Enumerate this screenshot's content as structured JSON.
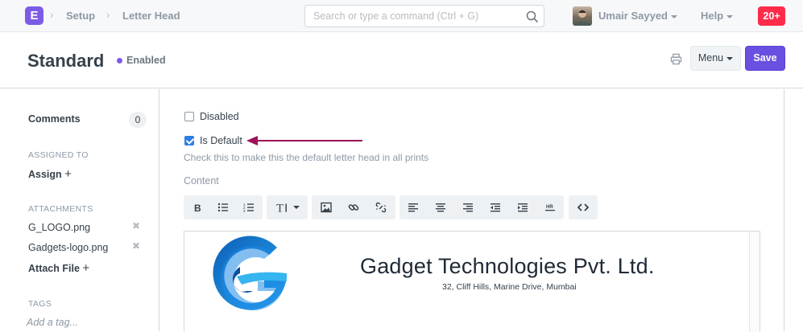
{
  "navbar": {
    "logo_letter": "E",
    "breadcrumbs": [
      "Setup",
      "Letter Head"
    ],
    "search_placeholder": "Search or type a command (Ctrl + G)",
    "user_name": "Umair Sayyed",
    "help_label": "Help",
    "notification_count": "20+"
  },
  "page": {
    "title": "Standard",
    "status": "Enabled",
    "menu_label": "Menu",
    "save_label": "Save"
  },
  "sidebar": {
    "comments_label": "Comments",
    "comments_count": "0",
    "assigned_to_label": "ASSIGNED TO",
    "assign_label": "Assign",
    "attachments_label": "ATTACHMENTS",
    "attachments": [
      "G_LOGO.png",
      "Gadgets-logo.png"
    ],
    "attach_file_label": "Attach File",
    "tags_label": "TAGS",
    "add_tag_placeholder": "Add a tag..."
  },
  "form": {
    "disabled_label": "Disabled",
    "disabled_checked": false,
    "is_default_label": "Is Default",
    "is_default_checked": true,
    "is_default_help": "Check this to make this the default letter head in all prints",
    "content_label": "Content"
  },
  "editor_toolbar": {
    "groups": [
      [
        "bold-icon",
        "bullet-list-icon",
        "numbered-list-icon"
      ],
      [
        "text-size-icon"
      ],
      [
        "image-icon",
        "link-icon",
        "unlink-icon"
      ],
      [
        "align-left-icon",
        "align-center-icon",
        "align-right-icon",
        "outdent-icon",
        "indent-icon",
        "horizontal-rule-icon"
      ],
      [
        "code-view-icon"
      ]
    ]
  },
  "letterhead": {
    "company_name": "Gadget Technologies Pvt. Ltd.",
    "address": "32, Cliff Hills, Marine Drive, Mumbai"
  },
  "colors": {
    "brand": "#7c5ce6",
    "primary_button": "#6a4fe0",
    "notification": "#ff2b4a",
    "annotation_arrow": "#9b1457",
    "logo_blue": "#1e88e5"
  }
}
